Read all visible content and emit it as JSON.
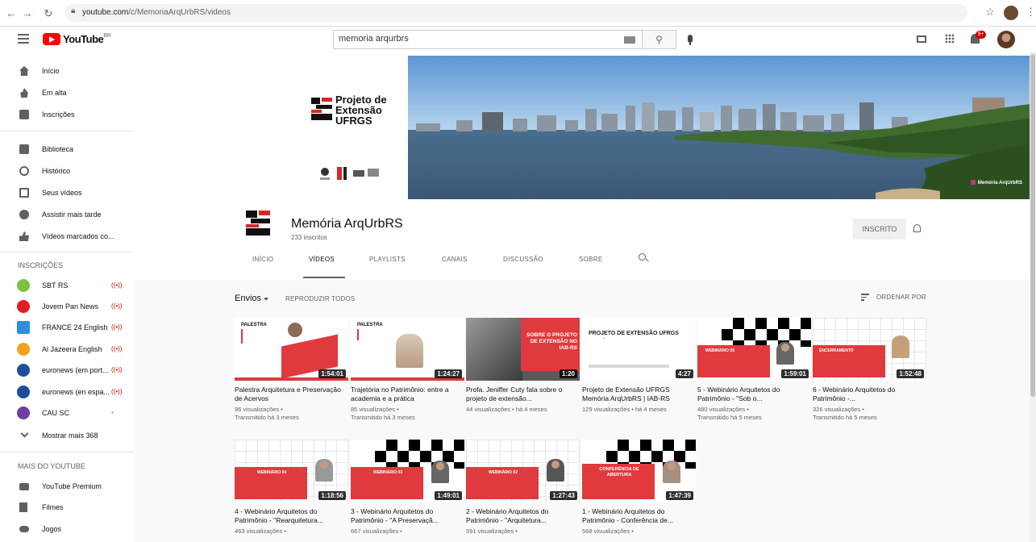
{
  "browser": {
    "url_host": "youtube.com",
    "url_path": "/c/MemoriaArqUrbRS/videos"
  },
  "header": {
    "logo_text": "YouTube",
    "logo_region": "BR",
    "search_query": "memoria arqurbrs",
    "notification_count": "9+"
  },
  "sidebar": {
    "main": [
      {
        "label": "Início",
        "icon": "home-icon"
      },
      {
        "label": "Em alta",
        "icon": "trending-icon"
      },
      {
        "label": "Inscrições",
        "icon": "subscriptions-icon"
      }
    ],
    "library": [
      {
        "label": "Biblioteca",
        "icon": "library-icon"
      },
      {
        "label": "Histórico",
        "icon": "history-icon"
      },
      {
        "label": "Seus vídeos",
        "icon": "your-videos-icon"
      },
      {
        "label": "Assistir mais tarde",
        "icon": "watch-later-icon"
      },
      {
        "label": "Vídeos marcados co...",
        "icon": "liked-videos-icon"
      }
    ],
    "subscriptions_heading": "INSCRIÇÕES",
    "subscriptions": [
      {
        "label": "SBT RS",
        "live": true,
        "color": "#7bc043"
      },
      {
        "label": "Jovem Pan News",
        "live": true,
        "color": "#e31b23"
      },
      {
        "label": "FRANCE 24 English",
        "live": true,
        "color": "#2f8fd8"
      },
      {
        "label": "Al Jazeera English",
        "live": true,
        "color": "#f4a11e"
      },
      {
        "label": "euronews (em port...",
        "live": true,
        "color": "#1b4f9c"
      },
      {
        "label": "euronews (en espa...",
        "live": true,
        "color": "#1b4f9c"
      },
      {
        "label": "CAU SC",
        "live": false,
        "color": "#6b3fa0"
      }
    ],
    "show_more": "Mostrar mais 368",
    "more_heading": "MAIS DO YOUTUBE",
    "more": [
      {
        "label": "YouTube Premium",
        "icon": "youtube-premium-icon"
      },
      {
        "label": "Filmes",
        "icon": "movies-icon"
      },
      {
        "label": "Jogos",
        "icon": "gaming-icon"
      }
    ]
  },
  "banner": {
    "title_line1": "Projeto de",
    "title_line2": "Extensão",
    "title_line3": "UFRGS",
    "handle": "Memória ArqUrbRS"
  },
  "channel": {
    "name": "Memória ArqUrbRS",
    "subscribers": "233 inscritos",
    "subscribe_label": "INSCRITO",
    "tabs": [
      "INÍCIO",
      "VÍDEOS",
      "PLAYLISTS",
      "CANAIS",
      "DISCUSSÃO",
      "SOBRE"
    ],
    "active_tab": "VÍDEOS"
  },
  "uploads": {
    "label": "Envios",
    "play_all": "REPRODUZIR TODOS",
    "sort": "ORDENAR POR"
  },
  "videos": [
    {
      "title": "Palestra Arquitetura e Preservação de Acervos",
      "views": "96 visualizações •",
      "age": "Transmitido há 3 meses",
      "duration": "1:54:01",
      "thumb_text": "PALESTRA"
    },
    {
      "title": "Trajetória no Patrimônio: entre a academia e a prática",
      "views": "85 visualizações •",
      "age": "Transmitido há 3 meses",
      "duration": "1:24:27",
      "thumb_text": "PALESTRA"
    },
    {
      "title": "Profa. Jeniffer Cuty fala sobre o projeto de extensão...",
      "views": "44 visualizações • há 4 meses",
      "age": "",
      "duration": "1:20",
      "thumb_text": "SOBRE O PROJETO DE EXTENSÃO NO IAB-RS"
    },
    {
      "title": "Projeto de Extensão UFRGS Memória ArqUrbRS | IAB-RS",
      "views": "129 visualizações • há 4 meses",
      "age": "",
      "duration": "4:27",
      "thumb_text": "PROJETO DE EXTENSÃO UFRGS MEMÓRIA ARQURBRS | IAB-RS"
    },
    {
      "title": "5 - Webinário Arquitetos do Patrimônio - \"Sob o...",
      "views": "480 visualizações •",
      "age": "Transmitido há 5 meses",
      "duration": "1:59:01",
      "thumb_text": "WEBINÁRIO 05"
    },
    {
      "title": "6 - Webinário Arquitetos do Patrimônio -...",
      "views": "326 visualizações •",
      "age": "Transmitido há 5 meses",
      "duration": "1:52:48",
      "thumb_text": "ENCERRAMENTO"
    },
    {
      "title": "4 - Webinário Arquitetos do Patrimônio - \"Rearquitetura...",
      "views": "463 visualizações •",
      "age": "",
      "duration": "1:18:56",
      "thumb_text": "WEBINÁRIO 04"
    },
    {
      "title": "3 - Webinário Arquitetos do Patrimônio - \"A Preservaçã...",
      "views": "667 visualizações •",
      "age": "",
      "duration": "1:49:01",
      "thumb_text": "WEBINÁRIO 03"
    },
    {
      "title": "2 - Webinário Arquitetos do Patrimônio - \"Arquitetura...",
      "views": "591 visualizações •",
      "age": "",
      "duration": "1:27:43",
      "thumb_text": "WEBINÁRIO 02"
    },
    {
      "title": "1 - Webinário Arquitetos do Patrimônio - Conferência de...",
      "views": "568 visualizações •",
      "age": "",
      "duration": "1:47:39",
      "thumb_text": "CONFERÊNCIA DE ABERTURA"
    }
  ]
}
